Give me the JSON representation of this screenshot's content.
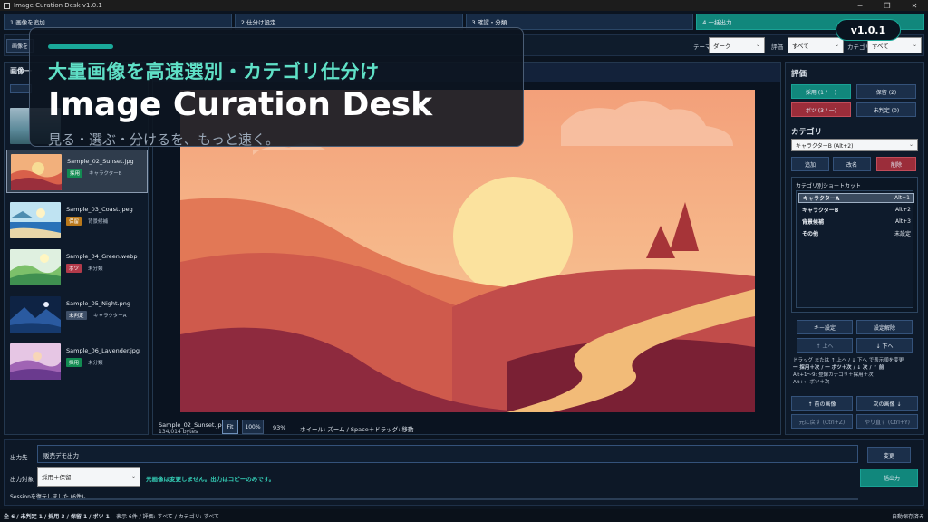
{
  "window": {
    "title": "Image Curation Desk v1.0.1"
  },
  "steps": [
    {
      "label": "1  画像を追加"
    },
    {
      "label": "2  仕分け設定"
    },
    {
      "label": "3  確認・分類"
    },
    {
      "label": "4  一括出力"
    }
  ],
  "toolbar": {
    "add_button_partial": "画像を",
    "theme_label": "テーマ",
    "theme_value": "ダーク",
    "rating_label": "評価",
    "rating_value": "すべて",
    "category_label": "カテゴリ",
    "category_value": "すべて"
  },
  "overlay": {
    "headline": "大量画像を高速選別・カテゴリ仕分け",
    "title": "Image Curation Desk",
    "tagline": "見る・選ぶ・分けるを、もっと速く。"
  },
  "version_badge": "v1.0.1",
  "left_panel": {
    "header_partial": "画像一",
    "items": [
      {
        "name": "Sample_02_Sunset.jpg",
        "badge": "採用",
        "badge_color": "#138b52",
        "category": "キャラクターB"
      },
      {
        "name": "Sample_03_Coast.jpeg",
        "badge": "保留",
        "badge_color": "#b9781a",
        "category": "背景候補"
      },
      {
        "name": "Sample_04_Green.webp",
        "badge": "ボツ",
        "badge_color": "#b23a4a",
        "category": "未分類"
      },
      {
        "name": "Sample_05_Night.png",
        "badge": "未判定",
        "badge_color": "#3f5068",
        "category": "キャラクターA"
      },
      {
        "name": "Sample_06_Lavender.jpg",
        "badge": "採用",
        "badge_color": "#138b52",
        "category": "未分類"
      }
    ]
  },
  "viewer": {
    "filename": "Sample_02_Sunset.jpg",
    "filesize": "134,014 bytes",
    "fit_label": "Fit",
    "zoom100_label": "100%",
    "zoom_value": "93%",
    "hint": "ホイール: ズーム / Space＋ドラッグ: 移動"
  },
  "right_panel": {
    "rating_title": "評価",
    "adopt": "採用 (1 / 一)",
    "hold": "保留 (2)",
    "reject": "ボツ (3 / 一)",
    "undecided": "未判定 (0)",
    "category_title": "カテゴリ",
    "category_select": "キャラクターB (Alt+2)",
    "add": "追加",
    "rename": "改名",
    "delete": "削除",
    "shortcut_title": "カテゴリ別ショートカット",
    "shortcuts": [
      {
        "name": "キャラクターA",
        "key": "Alt+1"
      },
      {
        "name": "キャラクターB",
        "key": "Alt+2"
      },
      {
        "name": "背景候補",
        "key": "Alt+3"
      },
      {
        "name": "その他",
        "key": "未設定"
      }
    ],
    "key_set": "キー設定",
    "key_clear": "設定解除",
    "move_up": "↑ 上へ",
    "move_down": "↓ 下へ",
    "help1": "ドラッグ または ↑ 上へ / ↓ 下へ で表示順を変更",
    "help2": "一 採用＋次 / 一 ボツ＋次 / ↓ 次 / ↑ 前",
    "help3": "Alt+1〜9: 登録カテゴリ＋採用＋次",
    "help4": "Alt+← ボツ＋次",
    "prev_image": "↑ 前の画像",
    "next_image": "次の画像 ↓",
    "undo": "元に戻す (Ctrl+Z)",
    "redo": "やり直す (Ctrl+Y)"
  },
  "bottom": {
    "output_dest_label": "出力先",
    "output_dest_value": "販売デモ出力",
    "change_button": "変更",
    "output_target_label": "出力対象",
    "output_target_value": "採用＋保留",
    "notice": "元画像は変更しません。出力はコピーのみです。",
    "export_button": "一括出力",
    "session_msg": "Sessionを復元しました (6件)。"
  },
  "status": {
    "counts": "全 6 / 未判定 1 / 採用 3 / 保留 1 / ボツ 1",
    "filter": "表示 6件 / 評価: すべて / カテゴリ: すべて",
    "autosave": "自動保存済み"
  },
  "colors": {
    "accent": "#11877c",
    "adopt": "#138b52",
    "reject": "#b23a4a",
    "panel": "#0e1a2a"
  }
}
